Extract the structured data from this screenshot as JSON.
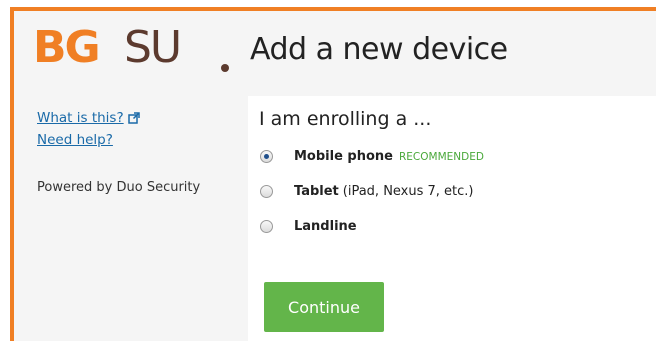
{
  "logo": {
    "bg": "BG",
    "su": "SU"
  },
  "sidebar": {
    "what_is_this": "What is this?",
    "need_help": "Need help?",
    "powered_by": "Powered by Duo Security"
  },
  "page": {
    "title": "Add a new device"
  },
  "form": {
    "question": "I am enrolling a ...",
    "options": [
      {
        "label": "Mobile phone",
        "extra": "",
        "badge": "RECOMMENDED",
        "selected": true
      },
      {
        "label": "Tablet",
        "extra": "(iPad, Nexus 7, etc.)",
        "badge": "",
        "selected": false
      },
      {
        "label": "Landline",
        "extra": "",
        "badge": "",
        "selected": false
      }
    ],
    "continue_label": "Continue"
  },
  "colors": {
    "accent_orange": "#f07f24",
    "logo_brown": "#5c3a2e",
    "link_blue": "#1a6aa8",
    "button_green": "#63b54a",
    "badge_green": "#4aa83a"
  }
}
